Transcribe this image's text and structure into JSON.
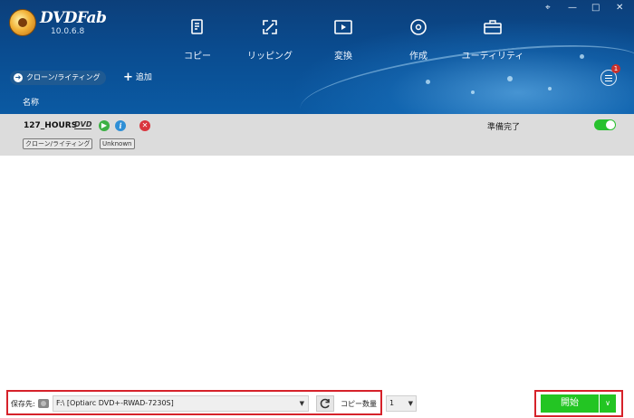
{
  "app": {
    "brand": "DVDFab",
    "version": "10.0.6.8"
  },
  "window_controls": {
    "pin": "⌖",
    "minimize": "—",
    "maximize": "□",
    "close": "✕"
  },
  "nav": [
    {
      "label": "コピー",
      "icon": "copy-icon"
    },
    {
      "label": "リッピング",
      "icon": "ripper-icon"
    },
    {
      "label": "変換",
      "icon": "converter-icon"
    },
    {
      "label": "作成",
      "icon": "creator-icon"
    },
    {
      "label": "ユーティリティ",
      "icon": "toolbox-icon"
    }
  ],
  "toolbar": {
    "mode_label": "クローン/ライティング",
    "add_label": "追加",
    "queue_badge": "1"
  },
  "list_header": {
    "name_col": "名称"
  },
  "task": {
    "title": "127_HOURS",
    "disc_type": "DVD",
    "status": "準備完了",
    "enabled": true,
    "tags": [
      "クローン/ライティング",
      "Unknown"
    ]
  },
  "bottom": {
    "save_label": "保存先:",
    "save_target": "F:\\ [Optiarc DVD+-RWAD-7230S]",
    "copy_count_label": "コピー数量",
    "copy_count": "1",
    "start_label": "開始"
  },
  "colors": {
    "header": "#0a4c90",
    "accent_green": "#23c523",
    "highlight_red": "#d6222a"
  }
}
